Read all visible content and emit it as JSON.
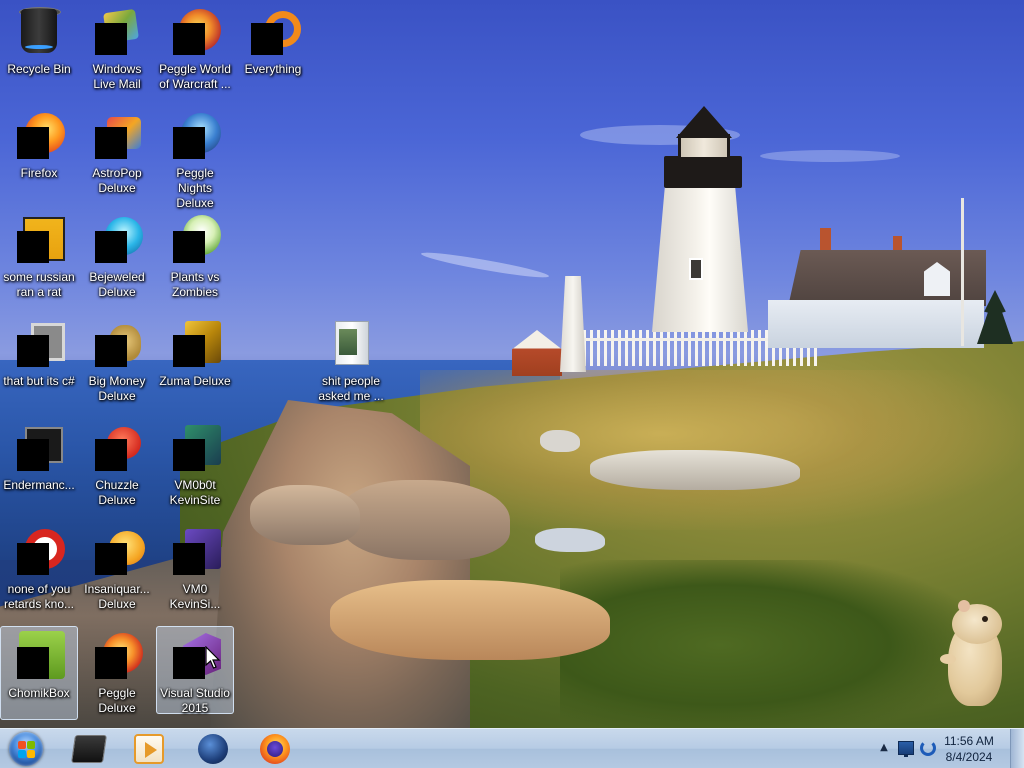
{
  "desktop": {
    "icons": [
      {
        "label": "Recycle Bin",
        "icon": "recycle-bin-icon"
      },
      {
        "label": "Windows Live Mail",
        "icon": "mail-icon"
      },
      {
        "label": "Peggle World of Warcraft ...",
        "icon": "peggle-icon"
      },
      {
        "label": "Everything",
        "icon": "search-icon"
      },
      {
        "label": "Firefox",
        "icon": "firefox-icon"
      },
      {
        "label": "AstroPop Deluxe",
        "icon": "game-icon"
      },
      {
        "label": "Peggle Nights Deluxe",
        "icon": "peggle-icon"
      },
      {
        "label": "some russian ran a rat",
        "icon": "script-icon"
      },
      {
        "label": "Bejeweled Deluxe",
        "icon": "gem-icon"
      },
      {
        "label": "Plants vs Zombies",
        "icon": "plant-icon"
      },
      {
        "label": "that but its c#",
        "icon": "stack-icon"
      },
      {
        "label": "Big Money Deluxe",
        "icon": "money-bag-icon"
      },
      {
        "label": "Zuma Deluxe",
        "icon": "game-icon"
      },
      {
        "label": "shit people asked me ...",
        "icon": "folder-icon"
      },
      {
        "label": "Endermanc...",
        "icon": "terminal-icon"
      },
      {
        "label": "Chuzzle Deluxe",
        "icon": "game-icon"
      },
      {
        "label": "VM0b0t KevinSite",
        "icon": "app-icon"
      },
      {
        "label": "none of you retards kno...",
        "icon": "opera-icon"
      },
      {
        "label": "Insaniquar... Deluxe",
        "icon": "fish-icon"
      },
      {
        "label": "VM0 KevinSi...",
        "icon": "app-icon"
      },
      {
        "label": "ChomikBox",
        "icon": "hamster-icon"
      },
      {
        "label": "Peggle Deluxe",
        "icon": "peggle-icon"
      },
      {
        "label": "Visual Studio 2015",
        "icon": "visual-studio-icon"
      }
    ]
  },
  "taskbar": {
    "start": {
      "icon": "windows-start-icon"
    },
    "pinned": [
      {
        "name": "command-prompt",
        "icon": "terminal-icon"
      },
      {
        "name": "windows-media-player",
        "icon": "media-player-icon"
      },
      {
        "name": "internet-explorer",
        "icon": "globe-icon"
      },
      {
        "name": "firefox",
        "icon": "firefox-icon"
      }
    ],
    "tray": {
      "expand_glyph": "▲",
      "time": "11:56 AM",
      "date": "8/4/2024"
    }
  },
  "colors": {
    "taskbar": "#b6cbe4",
    "selection": "#c8dcf5",
    "label_text": "#ffffff"
  }
}
